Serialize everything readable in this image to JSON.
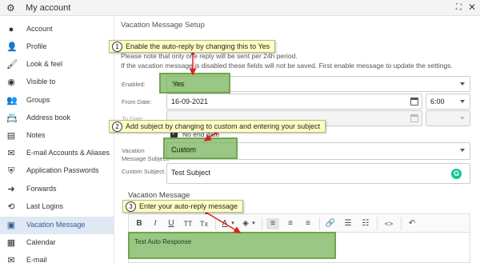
{
  "window": {
    "title": "My account",
    "expand_icon": "expand-icon",
    "close_glyph": "✕"
  },
  "sidebar": {
    "items": [
      {
        "label": "Account",
        "icon": "account-icon",
        "glyph": "●"
      },
      {
        "label": "Profile",
        "icon": "user-icon",
        "glyph": "👤"
      },
      {
        "label": "Look & feel",
        "icon": "paint-icon",
        "glyph": "🖌"
      },
      {
        "label": "Visible to",
        "icon": "eye-icon",
        "glyph": "◉"
      },
      {
        "label": "Groups",
        "icon": "groups-icon",
        "glyph": "👥"
      },
      {
        "label": "Address book",
        "icon": "address-book-icon",
        "glyph": "📇"
      },
      {
        "label": "Notes",
        "icon": "notes-icon",
        "glyph": "▤"
      },
      {
        "label": "E-mail Accounts & Aliases",
        "icon": "email-icon",
        "glyph": "✉"
      },
      {
        "label": "Application Passwords",
        "icon": "shield-icon",
        "glyph": "⛨"
      },
      {
        "label": "Forwards",
        "icon": "forward-icon",
        "glyph": "➜"
      },
      {
        "label": "Last Logins",
        "icon": "history-icon",
        "glyph": "⟲"
      },
      {
        "label": "Vacation Message",
        "icon": "briefcase-icon",
        "glyph": "▣",
        "active": true
      },
      {
        "label": "Calendar",
        "icon": "calendar-icon",
        "glyph": "▦"
      },
      {
        "label": "E-mail",
        "icon": "mail-icon",
        "glyph": "✉"
      }
    ]
  },
  "main": {
    "section_title": "Vacation Message Setup",
    "notice_line1": "Please note that only one reply will be sent per 24h period.",
    "notice_line2": "If the vacation message is disabled these fields will not be saved. First enable message to update the settings.",
    "enabled": {
      "label": "Enabled:",
      "value": "Yes"
    },
    "from_date": {
      "label": "From Date:",
      "date": "16-09-2021",
      "time": "6:00"
    },
    "to_date": {
      "label": "To Date:",
      "checkbox_label": "No end date"
    },
    "vacation_subject": {
      "label_line1": "Vacation",
      "label_line2": "Message Subject:",
      "value": "Custom"
    },
    "custom_subject": {
      "label": "Custom Subject:",
      "value": "Test Subject"
    },
    "message_header": "Vacation Message",
    "editor_content": "Test Auto Response",
    "toolbar": {
      "bold": "B",
      "italic": "I",
      "underline": "U",
      "font_size": "TT",
      "clear_format": "Tx",
      "font_color": "A",
      "dropdown_glyph": "▾",
      "bg_color_glyph": "◈",
      "align_left": "≡",
      "align_center": "≡",
      "align_right": "≡",
      "link": "🔗",
      "list_bullet": "☰",
      "list_number": "☷",
      "code": "<>",
      "undo": "↶"
    }
  },
  "annotations": [
    {
      "num": "1",
      "text": "Enable the auto-reply by changing this to Yes"
    },
    {
      "num": "2",
      "text": "Add subject by changing to custom and entering your subject"
    },
    {
      "num": "3",
      "text": "Enter your auto-reply message"
    }
  ],
  "colors": {
    "highlight": "#75b254",
    "callout": "#ffffc4",
    "arrow": "#e02020",
    "active_nav": "#dfe8f3"
  }
}
